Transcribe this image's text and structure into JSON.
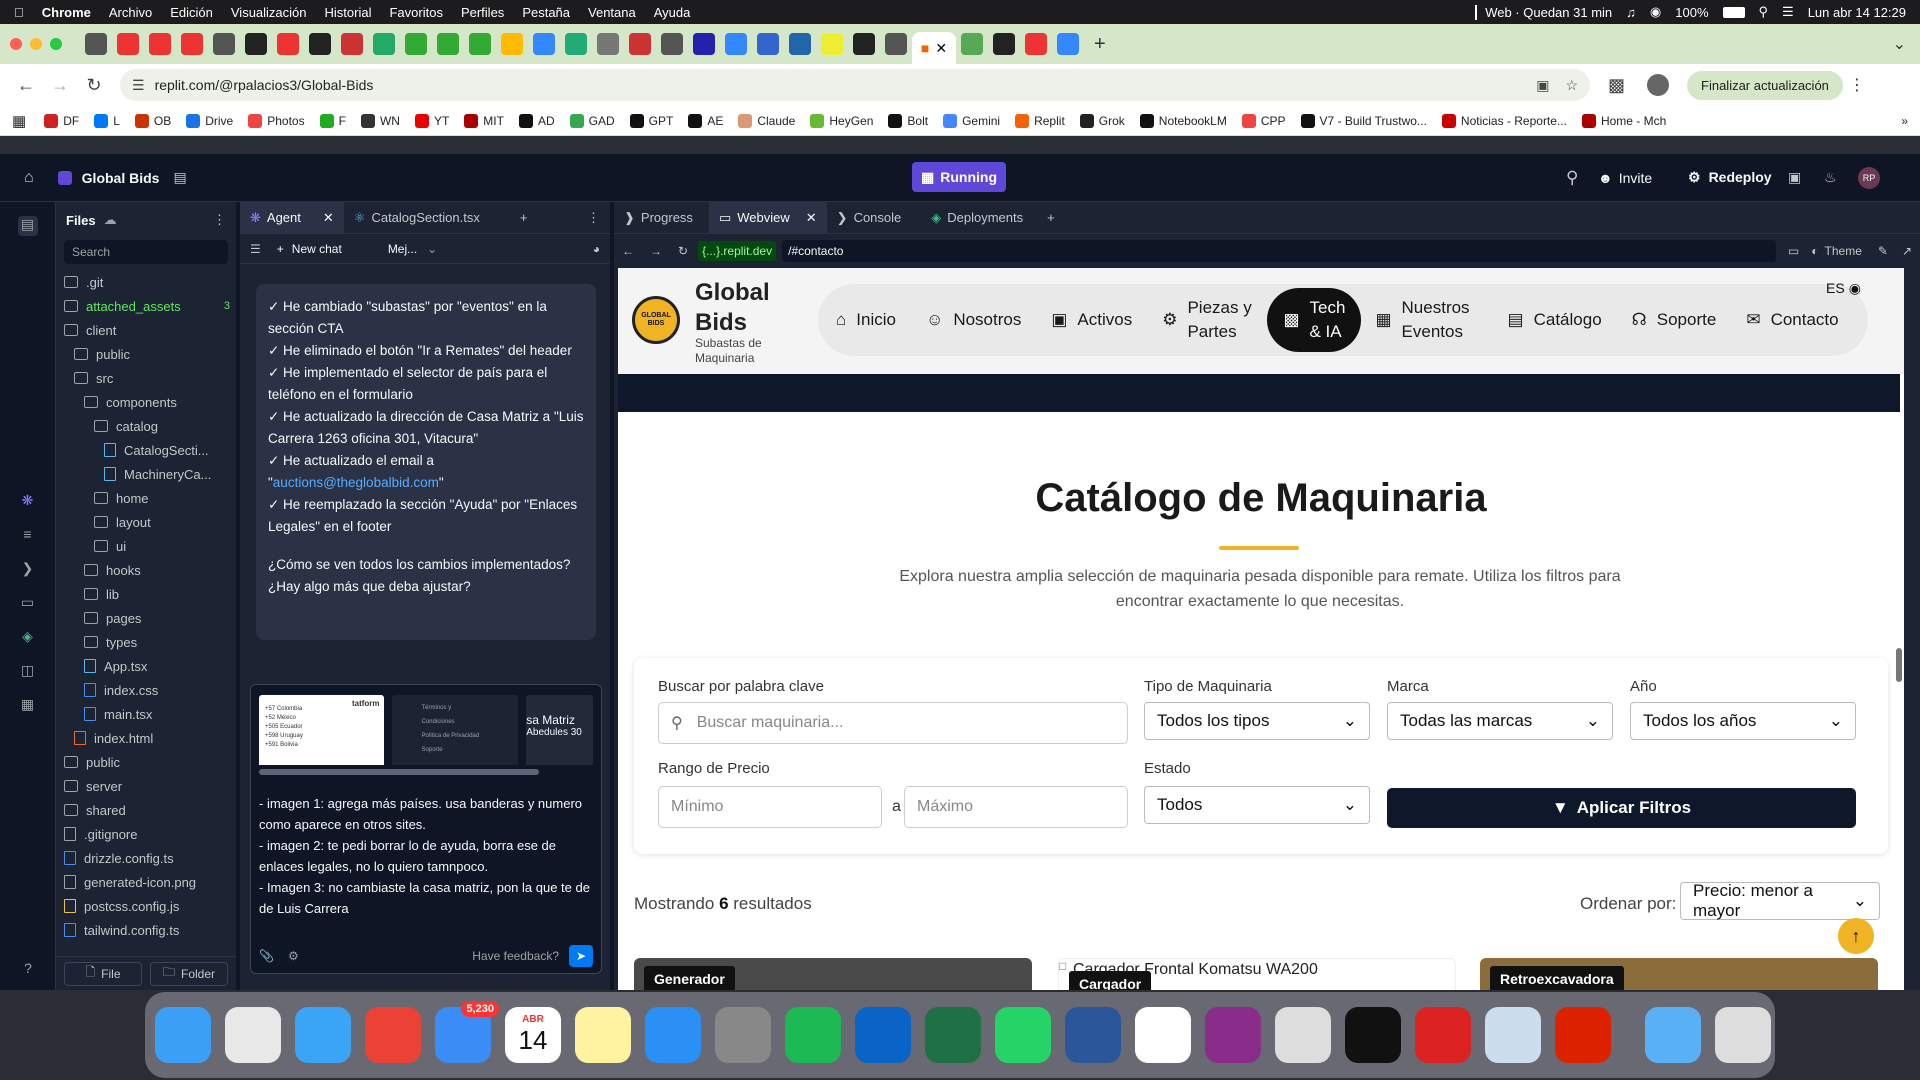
{
  "menubar": {
    "app": "Chrome",
    "items": [
      "Archivo",
      "Edición",
      "Visualización",
      "Historial",
      "Favoritos",
      "Perfiles",
      "Pestaña",
      "Ventana",
      "Ayuda"
    ],
    "web_time": "Web · Quedan 31 min",
    "battery": "100%",
    "datetime": "Lun abr 14  12:29"
  },
  "browser": {
    "url": "replit.com/@rpalacios3/Global-Bids",
    "update_button": "Finalizar actualización",
    "bookmarks": [
      "DF",
      "L",
      "OB",
      "Drive",
      "Photos",
      "F",
      "WN",
      "YT",
      "MIT",
      "AD",
      "GAD",
      "GPT",
      "AE",
      "Claude",
      "HeyGen",
      "Bolt",
      "Gemini",
      "Replit",
      "Grok",
      "NotebookLM",
      "CPP",
      "V7 - Build Trustwo...",
      "Noticias - Reporte...",
      "Home - Mch"
    ]
  },
  "replit": {
    "project": "Global Bids",
    "running": "Running",
    "invite": "Invite",
    "redeploy": "Redeploy",
    "avatar": "RP"
  },
  "files": {
    "title": "Files",
    "search_placeholder": "Search",
    "badge": "3",
    "new_file": "File",
    "new_folder": "Folder",
    "tree": [
      {
        "name": ".git",
        "type": "folder",
        "indent": 0
      },
      {
        "name": "attached_assets",
        "type": "folder",
        "indent": 0,
        "highlight": true
      },
      {
        "name": "client",
        "type": "folder",
        "indent": 0
      },
      {
        "name": "public",
        "type": "folder",
        "indent": 1
      },
      {
        "name": "src",
        "type": "folder",
        "indent": 1
      },
      {
        "name": "components",
        "type": "folder",
        "indent": 2
      },
      {
        "name": "catalog",
        "type": "folder",
        "indent": 3
      },
      {
        "name": "CatalogSecti...",
        "type": "react",
        "indent": 4
      },
      {
        "name": "MachineryCa...",
        "type": "react",
        "indent": 4
      },
      {
        "name": "home",
        "type": "folder",
        "indent": 3
      },
      {
        "name": "layout",
        "type": "folder",
        "indent": 3
      },
      {
        "name": "ui",
        "type": "folder",
        "indent": 3
      },
      {
        "name": "hooks",
        "type": "folder",
        "indent": 2
      },
      {
        "name": "lib",
        "type": "folder",
        "indent": 2
      },
      {
        "name": "pages",
        "type": "folder",
        "indent": 2
      },
      {
        "name": "types",
        "type": "folder",
        "indent": 2
      },
      {
        "name": "App.tsx",
        "type": "react",
        "indent": 2
      },
      {
        "name": "index.css",
        "type": "css",
        "indent": 2
      },
      {
        "name": "main.tsx",
        "type": "ts",
        "indent": 2
      },
      {
        "name": "index.html",
        "type": "html",
        "indent": 1
      },
      {
        "name": "public",
        "type": "folder",
        "indent": 0
      },
      {
        "name": "server",
        "type": "folder",
        "indent": 0
      },
      {
        "name": "shared",
        "type": "folder",
        "indent": 0
      },
      {
        "name": ".gitignore",
        "type": "file",
        "indent": 0
      },
      {
        "name": "drizzle.config.ts",
        "type": "ts",
        "indent": 0
      },
      {
        "name": "generated-icon.png",
        "type": "img",
        "indent": 0
      },
      {
        "name": "postcss.config.js",
        "type": "js",
        "indent": 0
      },
      {
        "name": "tailwind.config.ts",
        "type": "ts",
        "indent": 0
      }
    ]
  },
  "agent": {
    "tab1": "Agent",
    "tab2": "CatalogSection.tsx",
    "new_chat": "New chat",
    "model": "Mej...",
    "messages": [
      "✓ He cambiado \"subastas\" por \"eventos\" en la sección CTA",
      "✓ He eliminado el botón \"Ir a Remates\" del header",
      "✓ He implementado el selector de país para el teléfono en el formulario",
      "✓ He actualizado la dirección de Casa Matriz a \"Luis Carrera 1263 oficina 301, Vitacura\"",
      "✓ He actualizado el email a"
    ],
    "email": "auctions@theglobalbid.com",
    "more": [
      "✓ He reemplazado la sección \"Ayuda\" por \"Enlaces Legales\" en el footer"
    ],
    "question": "¿Cómo se ven todos los cambios implementados? ¿Hay algo más que deba ajustar?",
    "thumb1": [
      "+57 Colombia",
      "+52 México",
      "+505 Ecuador",
      "+598 Uruguay",
      "+591 Bolivia"
    ],
    "thumb1_side": "tatform",
    "thumb2": [
      "Términos y",
      "Condiciones",
      "Política de Privacidad",
      "Soporte"
    ],
    "thumb3": [
      "sa Matriz",
      "Abedules 30"
    ],
    "input": "- imagen 1: agrega más países. usa banderas y numero como aparece en otros sites.\n- imagen 2: te pedi borrar lo de ayuda, borra ese de enlaces legales, no lo quiero tamnpoco.\n- Imagen 3: no cambiaste la casa matriz, pon la que te de de Luis Carrera",
    "feedback": "Have feedback?"
  },
  "webview": {
    "tabs": [
      "Progress",
      "Webview",
      "Console",
      "Deployments"
    ],
    "url_domain": "{...}.replit.dev",
    "url_path": "/#contacto",
    "theme": "Theme"
  },
  "site": {
    "brand": "Global Bids",
    "brand_sub": "Subastas de Maquinaria",
    "logo_text": "GLOBAL BIDS",
    "lang": "ES",
    "nav": [
      "Inicio",
      "Nosotros",
      "Activos",
      "Piezas y Partes",
      "Tech & IA",
      "Nuestros Eventos",
      "Catálogo",
      "Soporte",
      "Contacto"
    ],
    "title": "Catálogo de Maquinaria",
    "subtitle": "Explora nuestra amplia selección de maquinaria pesada disponible para remate. Utiliza los filtros para encontrar exactamente lo que necesitas.",
    "filters": {
      "keyword_label": "Buscar por palabra clave",
      "keyword_placeholder": "Buscar maquinaria...",
      "type_label": "Tipo de Maquinaria",
      "type_value": "Todos los tipos",
      "brand_label": "Marca",
      "brand_value": "Todas las marcas",
      "year_label": "Año",
      "year_value": "Todos los años",
      "price_label": "Rango de Precio",
      "min_placeholder": "Mínimo",
      "sep": "a",
      "max_placeholder": "Máximo",
      "state_label": "Estado",
      "state_value": "Todos",
      "apply": "Aplicar Filtros"
    },
    "results_prefix": "Mostrando",
    "results_count": "6",
    "results_suffix": "resultados",
    "sort_label": "Ordenar por:",
    "sort_value": "Precio: menor a mayor",
    "cards": [
      "Generador",
      "Cargador",
      "Retroexcavadora"
    ],
    "card2_alt": "Cargador Frontal Komatsu WA200"
  },
  "dock": {
    "mail_badge": "5,230",
    "cal_month": "ABR",
    "cal_day": "14"
  },
  "colors": {
    "accent": "#f0b323",
    "dark": "#0f172a",
    "replit_bg": "#0e1525",
    "replit_panel": "#1c2333",
    "running": "#5f48d8"
  }
}
